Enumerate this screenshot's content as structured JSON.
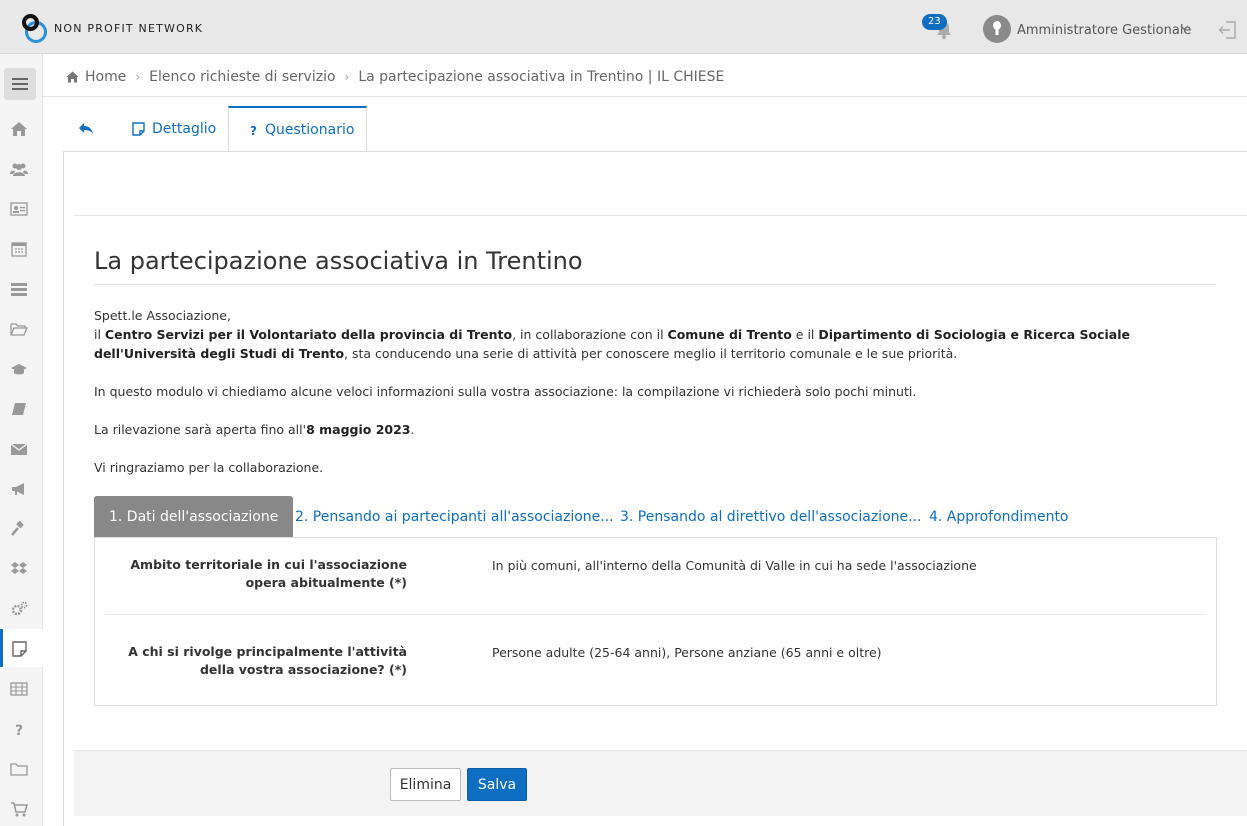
{
  "header": {
    "brand": "NON PROFIT NETWORK",
    "notifications_count": "23",
    "user_name": "Amministratore Gestionale"
  },
  "breadcrumb": {
    "home": "Home",
    "list": "Elenco richieste di servizio",
    "current": "La partecipazione associativa in Trentino | IL CHIESE"
  },
  "tabs": {
    "detail": "Dettaglio",
    "questionnaire": "Questionario"
  },
  "content": {
    "title": "La partecipazione associativa in Trentino",
    "greeting": "Spett.le Associazione,",
    "p1_a": "il ",
    "p1_b": "Centro Servizi per il Volontariato della provincia di Trento",
    "p1_c": ", in collaborazione con il ",
    "p1_d": "Comune di Trento",
    "p1_e": " e il ",
    "p1_f": "Dipartimento di Sociologia e Ricerca Sociale dell'Università degli Studi di Trento",
    "p1_g": ", sta conducendo una serie di attività per conoscere meglio il territorio comunale e le sue priorità.",
    "p2": "In questo modulo vi chiediamo alcune veloci informazioni sulla vostra associazione: la compilazione vi richiederà solo pochi minuti.",
    "p3_a": "La rilevazione sarà aperta fino all'",
    "p3_b": "8 maggio 2023",
    "p3_c": ".",
    "p4": "Vi ringraziamo per la collaborazione."
  },
  "subtabs": [
    "1. Dati dell'associazione",
    "2. Pensando ai partecipanti all'associazione...",
    "3. Pensando al direttivo dell'associazione...",
    "4. Approfondimento"
  ],
  "questions": [
    {
      "label_line1": "Ambito territoriale in cui l'associazione",
      "label_line2": "opera abitualmente (*)",
      "answer": "In più comuni, all'interno della Comunità di Valle in cui ha sede l'associazione"
    },
    {
      "label_line1": "A chi si rivolge principalmente l'attività",
      "label_line2": "della vostra associazione? (*)",
      "answer": "Persone adulte (25-64 anni), Persone anziane (65 anni e oltre)"
    }
  ],
  "footer": {
    "delete_label": "Elimina",
    "save_label": "Salva"
  },
  "colors": {
    "accent": "#0d6ec2",
    "active_subtab": "#888888"
  }
}
